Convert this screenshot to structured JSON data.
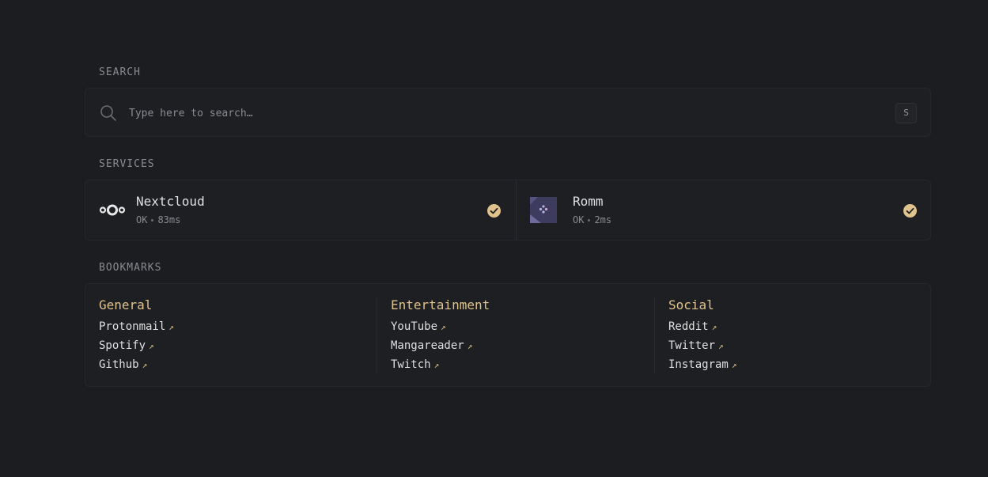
{
  "search": {
    "title": "SEARCH",
    "placeholder": "Type here to search…",
    "hotkey": "S"
  },
  "services": {
    "title": "SERVICES",
    "items": [
      {
        "name": "Nextcloud",
        "status": "OK",
        "latency": "83ms",
        "icon": "nextcloud-icon"
      },
      {
        "name": "Romm",
        "status": "OK",
        "latency": "2ms",
        "icon": "romm-icon"
      }
    ],
    "check_color": "#e0c38c"
  },
  "bookmarks": {
    "title": "BOOKMARKS",
    "groups": [
      {
        "title": "General",
        "links": [
          "Protonmail",
          "Spotify",
          "Github"
        ]
      },
      {
        "title": "Entertainment",
        "links": [
          "YouTube",
          "Mangareader",
          "Twitch"
        ]
      },
      {
        "title": "Social",
        "links": [
          "Reddit",
          "Twitter",
          "Instagram"
        ]
      }
    ]
  },
  "colors": {
    "accent": "#e0c38c",
    "background": "#1c1d21"
  }
}
